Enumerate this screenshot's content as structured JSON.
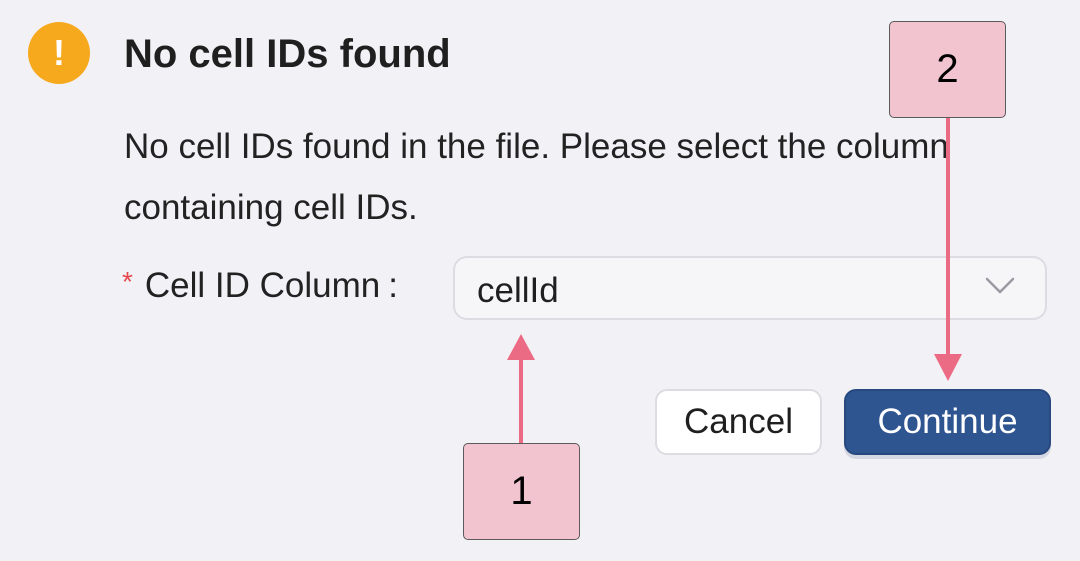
{
  "dialog": {
    "title": "No cell IDs found",
    "message": "No cell IDs found in the file. Please select the column containing cell IDs.",
    "warning_icon_glyph": "!",
    "field": {
      "required_mark": "*",
      "label": "Cell ID Column",
      "colon": ":",
      "selected_value": "cellId"
    },
    "buttons": {
      "cancel": "Cancel",
      "continue": "Continue"
    }
  },
  "annotations": [
    {
      "label": "1",
      "points_to": "cell-id-column-select"
    },
    {
      "label": "2",
      "points_to": "continue-button"
    }
  ],
  "colors": {
    "background": "#f2f1f6",
    "warning": "#f7a91e",
    "primary_button": "#2f5591",
    "required_star": "#e5484d",
    "callout_fill": "#f2c4cf",
    "arrow": "#ec6b84"
  }
}
